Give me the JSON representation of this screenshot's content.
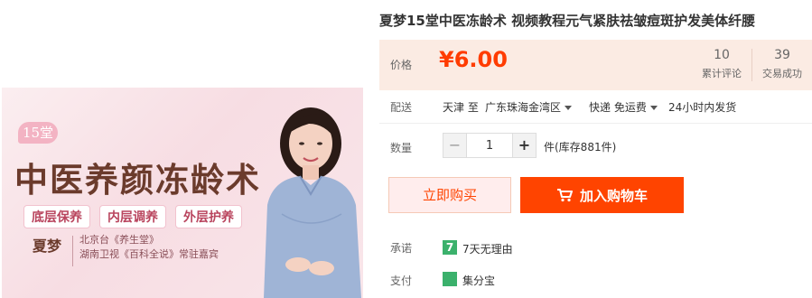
{
  "product_image": {
    "badge": "15堂",
    "title": "中医养颜冻龄术",
    "tags": [
      "底层保养",
      "内层调养",
      "外层护养"
    ],
    "person_name": "夏梦",
    "credit_line1": "北京台《养生堂》",
    "credit_line2": "湖南卫视《百科全说》常驻嘉宾"
  },
  "product": {
    "title": "夏梦15堂中医冻龄术 视频教程元气紧肤祛皱痘斑护发美体纤腰"
  },
  "price": {
    "label": "价格",
    "value": "¥6.00",
    "reviews_count": "10",
    "reviews_label": "累计评论",
    "deals_count": "39",
    "deals_label": "交易成功"
  },
  "shipping": {
    "label": "配送",
    "from": "天津",
    "to_word": "至",
    "destination": "广东珠海金湾区",
    "method": "快递 免运费",
    "dispatch": "24小时内发货"
  },
  "quantity": {
    "label": "数量",
    "minus": "−",
    "value": "1",
    "plus": "+",
    "stock": "件(库存881件)"
  },
  "actions": {
    "buy_now": "立即购买",
    "add_to_cart": "加入购物车"
  },
  "promise": {
    "label": "承诺",
    "icon_text": "7",
    "text": "7天无理由"
  },
  "payment": {
    "label": "支付",
    "text": "集分宝"
  },
  "colors": {
    "accent": "#ff4400",
    "price": "#ff3c00",
    "price_band": "#fbebe3",
    "promise_icon": "#3bb16c"
  }
}
